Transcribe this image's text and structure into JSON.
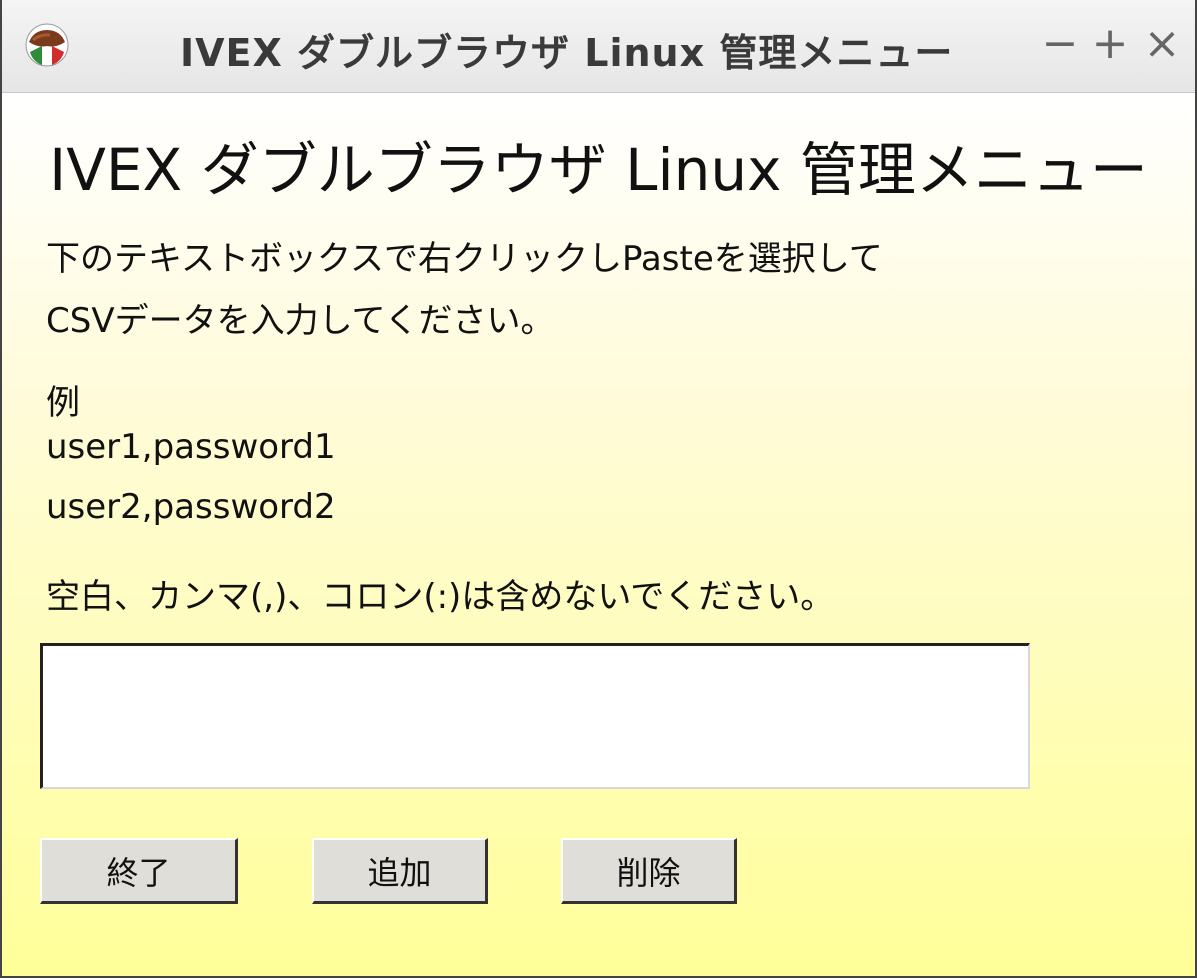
{
  "window": {
    "title": "IVEX ダブルブラウザ Linux 管理メニュー",
    "controls": {
      "minimize": "−",
      "maximize": "+",
      "close": "×"
    },
    "icon": "app-icon"
  },
  "main": {
    "heading": "IVEX ダブルブラウザ Linux 管理メニュー",
    "instruction_line1": "下のテキストボックスで右クリックしPasteを選択して",
    "instruction_line2": "CSVデータを入力してください。",
    "example_label": "例",
    "example_line1": "user1,password1",
    "example_line2": "user2,password2",
    "note": "空白、カンマ(,)、コロン(:)は含めないでください。",
    "csv_input": {
      "value": "",
      "placeholder": ""
    }
  },
  "buttons": {
    "exit": "終了",
    "add": "追加",
    "delete": "削除"
  },
  "colors": {
    "background_top": "#ffffff",
    "background_bottom": "#ffff99",
    "button_face": "#e0ded8"
  }
}
